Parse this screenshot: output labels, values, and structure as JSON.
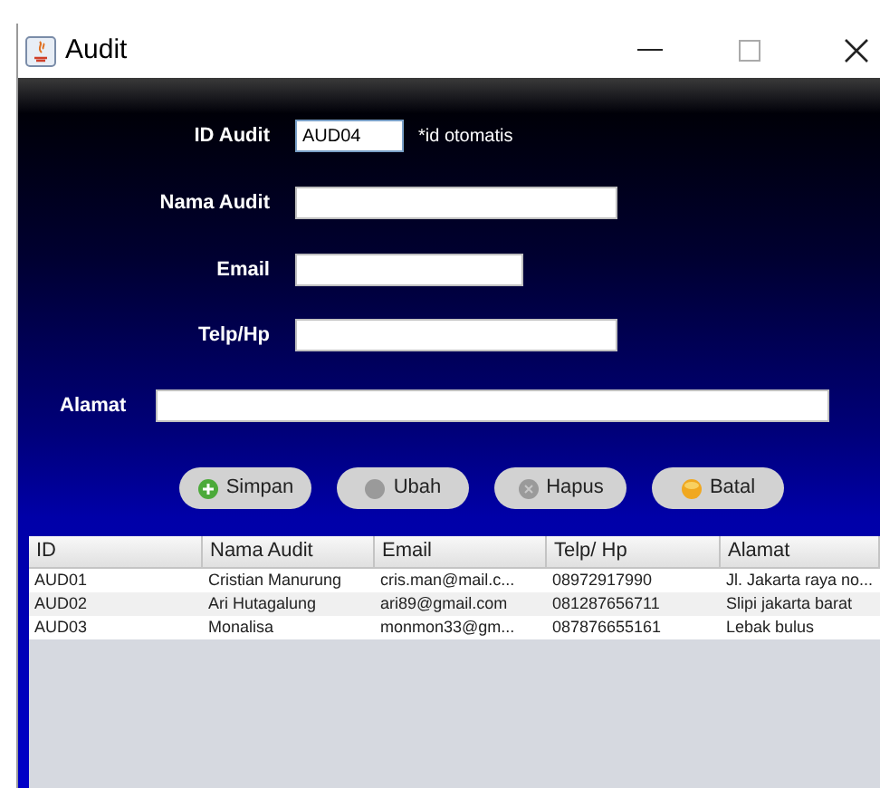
{
  "window": {
    "title": "Audit"
  },
  "form": {
    "fields": [
      {
        "label": "ID Audit",
        "value": "AUD04",
        "note": "*id otomatis"
      },
      {
        "label": "Nama Audit"
      },
      {
        "label": "Email"
      },
      {
        "label": "Telp/Hp"
      },
      {
        "label": "Alamat"
      }
    ]
  },
  "buttons": [
    {
      "label": "Simpan",
      "kind": "plus"
    },
    {
      "label": "Ubah",
      "kind": "refresh"
    },
    {
      "label": "Hapus",
      "kind": "cross"
    },
    {
      "label": "Batal",
      "kind": "dot"
    }
  ],
  "table": {
    "columns": [
      "ID",
      "Nama Audit",
      "Email",
      "Telp/ Hp",
      "Alamat"
    ],
    "rows": [
      [
        "AUD01",
        "Cristian Manurung",
        "cris.man@mail.c...",
        "08972917990",
        "Jl. Jakarta raya no..."
      ],
      [
        "AUD02",
        "Ari Hutagalung",
        "ari89@gmail.com",
        "081287656711",
        "Slipi jakarta barat"
      ],
      [
        "AUD03",
        "Monalisa",
        "monmon33@gm...",
        "087876655161",
        "Lebak bulus"
      ]
    ]
  }
}
